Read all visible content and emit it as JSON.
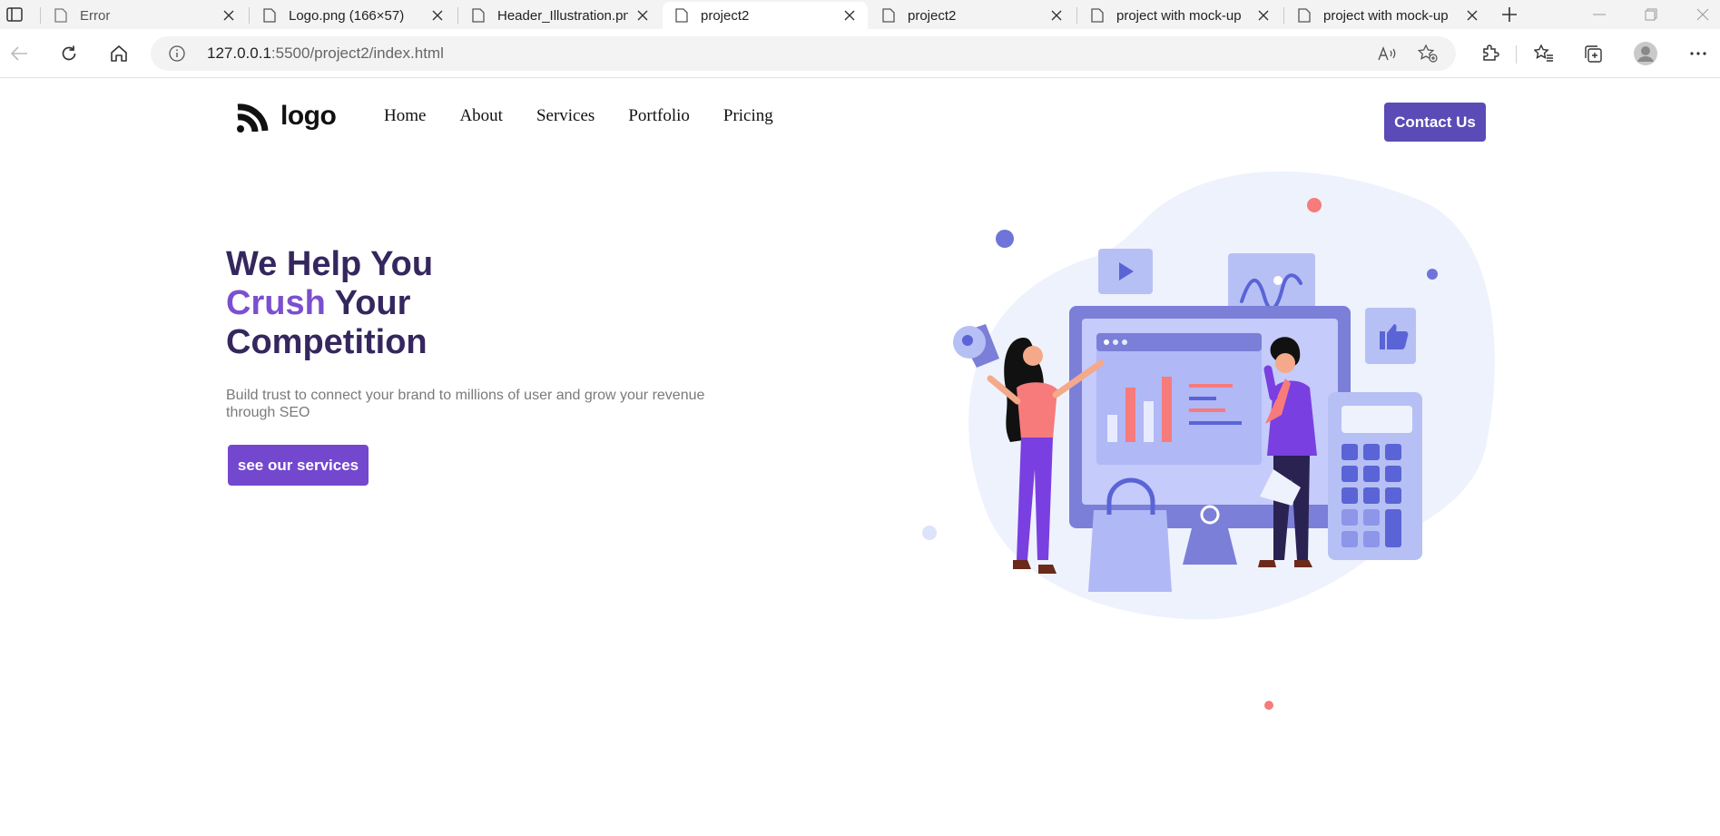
{
  "browser": {
    "tabs": [
      {
        "title": "Error",
        "active": false
      },
      {
        "title": "Logo.png (166×57)",
        "active": false
      },
      {
        "title": "Header_Illustration.png",
        "active": false
      },
      {
        "title": "project2",
        "active": true
      },
      {
        "title": "project2",
        "active": false
      },
      {
        "title": "project with mock-up",
        "active": false
      },
      {
        "title": "project with mock-up",
        "active": false
      }
    ],
    "url_host": "127.0.0.1",
    "url_rest": ":5500/project2/index.html"
  },
  "site": {
    "logo_text": "logo",
    "nav": [
      "Home",
      "About",
      "Services",
      "Portfolio",
      "Pricing"
    ],
    "contact_label": "Contact Us",
    "hero": {
      "title_line1": "We Help You",
      "title_accent": "Crush",
      "title_line2_rest": " Your",
      "title_line3": "Competition",
      "subtitle": "Build trust to connect your brand to millions of user and grow your revenue through SEO",
      "cta_label": "see our services"
    }
  },
  "colors": {
    "primary": "#5a4bb6",
    "cta": "#7447cf",
    "heading": "#35275e",
    "accent": "#7b4fcf"
  },
  "icons": {
    "tab_actions": "tab-actions-icon",
    "page": "page-icon",
    "close": "close-icon",
    "new_tab": "plus-icon",
    "back": "back-arrow-icon",
    "refresh": "refresh-icon",
    "home": "home-icon",
    "info": "info-icon",
    "read_aloud": "read-aloud-icon",
    "favorite_add": "star-plus-icon",
    "extensions": "puzzle-icon",
    "favorites": "favorites-icon",
    "collections": "collections-icon",
    "profile": "profile-icon",
    "menu": "more-icon"
  }
}
